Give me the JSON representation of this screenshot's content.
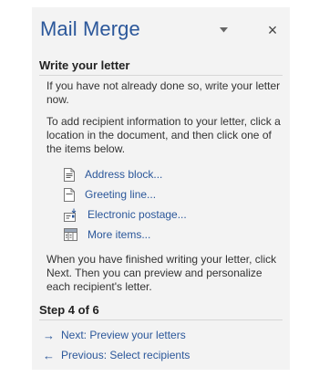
{
  "pane": {
    "title": "Mail Merge",
    "options_icon": "dropdown-arrow-icon",
    "close_glyph": "×",
    "section_title": "Write your letter",
    "intro": "If you have not already done so, write your letter now.",
    "instructions": "To add recipient information to your letter, click a location in the document, and then click one of the items below.",
    "items": [
      {
        "label": "Address block...",
        "icon": "address-block-icon"
      },
      {
        "label": "Greeting line...",
        "icon": "greeting-line-icon"
      },
      {
        "label": "Electronic postage...",
        "icon": "electronic-postage-icon"
      },
      {
        "label": "More items...",
        "icon": "more-items-icon"
      }
    ],
    "finish_text": "When you have finished writing your letter, click Next. Then you can preview and personalize each recipient's letter.",
    "step_label": "Step 4 of 6",
    "next_label": "Next: Preview your letters",
    "previous_label": "Previous: Select recipients",
    "accent_color": "#2b579a"
  }
}
